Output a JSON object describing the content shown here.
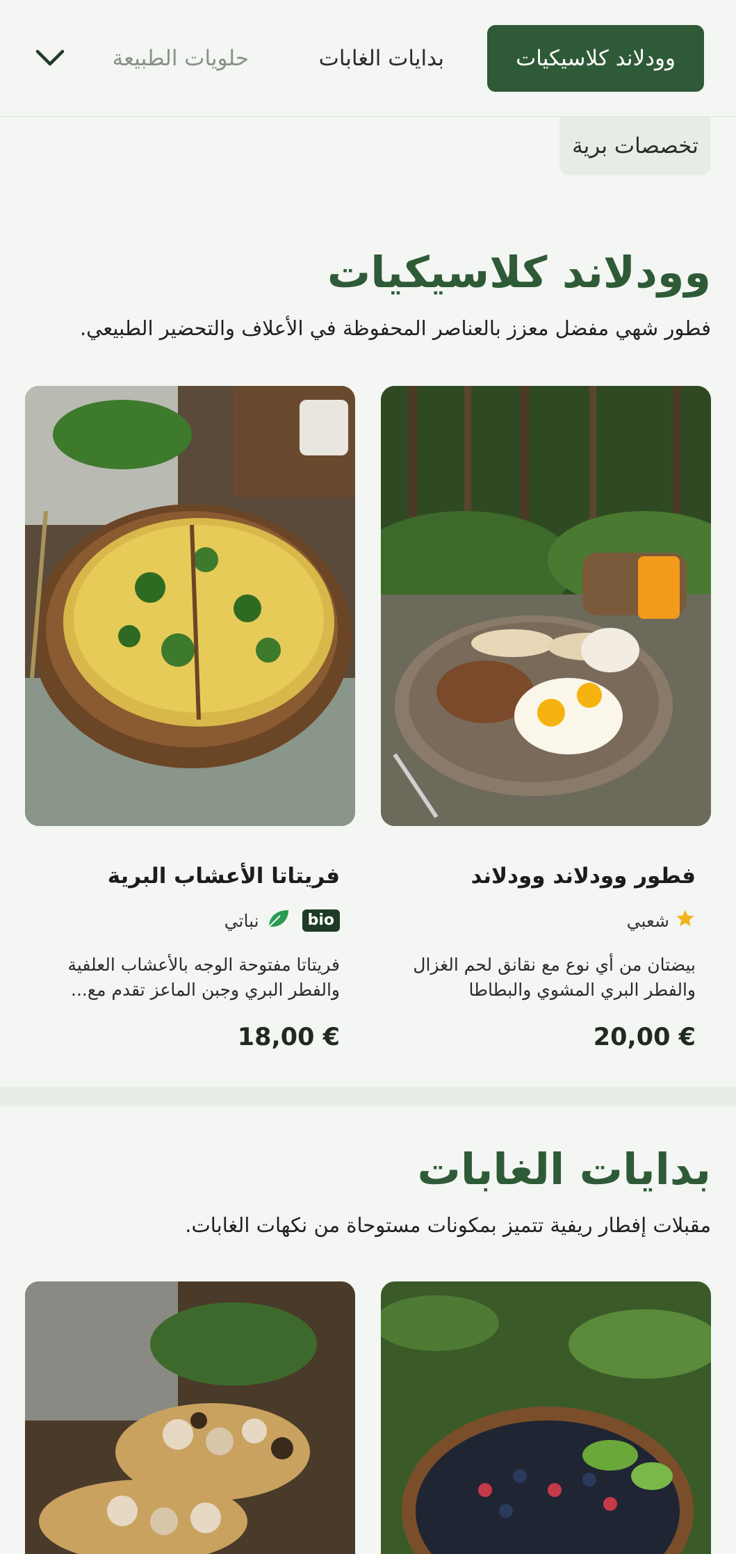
{
  "nav": {
    "tabs": [
      {
        "label": "وودلاند كلاسيكيات",
        "active": true
      },
      {
        "label": "بدايات الغابات",
        "active": false
      },
      {
        "label": "حلويات الطبيعة",
        "active": false
      },
      {
        "label": "تخصصات برية",
        "active": false
      }
    ],
    "expand_icon": "chevron-down-icon"
  },
  "sections": [
    {
      "title": "وودلاند كلاسيكيات",
      "description": "فطور شهي مفضل معزز بالعناصر المحفوظة في الأعلاف والتحضير الطبيعي.",
      "items": [
        {
          "name": "فطور وودلاند وودلاند",
          "tags": [
            {
              "icon": "star-icon",
              "label": "شعبي"
            }
          ],
          "description": "بيضتان من أي نوع مع نقانق لحم الغزال والفطر البري المشوي والبطاطا الروست...",
          "price": "20,00 €"
        },
        {
          "name": "فريتاتا الأعشاب البرية",
          "tags": [
            {
              "badge": "bio"
            },
            {
              "icon": "vegan-leaf-icon",
              "label": "نباتي"
            }
          ],
          "description": "فريتاتا مفتوحة الوجه بالأعشاب العلفية والفطر البري وجبن الماعز تقدم مع...",
          "price": "18,00 €"
        }
      ]
    },
    {
      "title": "بدايات الغابات",
      "description": "مقبلات إفطار ريفية تتميز بمكونات مستوحاة من نكهات الغابات.",
      "items": []
    }
  ],
  "colors": {
    "accent": "#2f5a37",
    "background": "#f3f6f2",
    "star": "#f2b31b",
    "vegan": "#2a9a52"
  }
}
